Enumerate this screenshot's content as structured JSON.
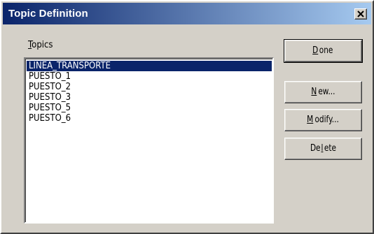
{
  "window": {
    "title": "Topic Definition",
    "close_icon": "close-x-icon"
  },
  "topics": {
    "label_mnemonic": "T",
    "label_rest": "opics",
    "items": [
      {
        "label": "LINEA_TRANSPORTE",
        "selected": true
      },
      {
        "label": "PUESTO_1",
        "selected": false
      },
      {
        "label": "PUESTO_2",
        "selected": false
      },
      {
        "label": "PUESTO_3",
        "selected": false
      },
      {
        "label": "PUESTO_5",
        "selected": false
      },
      {
        "label": "PUESTO_6",
        "selected": false
      }
    ]
  },
  "buttons": {
    "done": {
      "mnemonic": "D",
      "rest": "one"
    },
    "new": {
      "mnemonic": "N",
      "rest": "ew..."
    },
    "modify": {
      "mnemonic": "M",
      "rest": "odify..."
    },
    "delete": {
      "pre": "De",
      "mnemonic": "l",
      "rest": "ete"
    }
  },
  "colors": {
    "title_gradient_start": "#0a246a",
    "title_gradient_end": "#a6caf0",
    "selection": "#0a246a",
    "face": "#d4d0c8"
  }
}
